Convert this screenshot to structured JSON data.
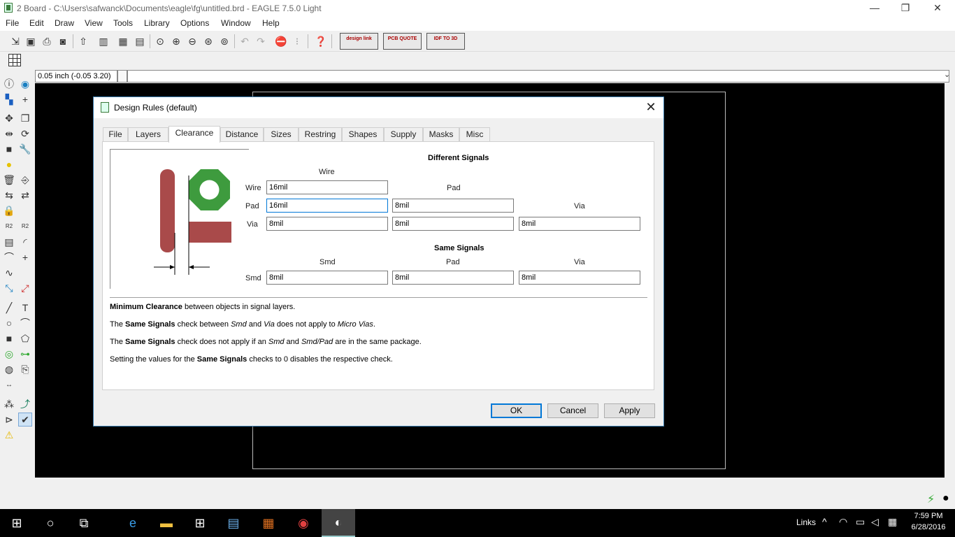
{
  "window": {
    "title": "2 Board - C:\\Users\\safwanck\\Documents\\eagle\\fg\\untitled.brd - EAGLE 7.5.0 Light",
    "minimize": "—",
    "maximize": "❐",
    "close": "✕"
  },
  "menu": [
    "File",
    "Edit",
    "Draw",
    "View",
    "Tools",
    "Library",
    "Options",
    "Window",
    "Help"
  ],
  "toolbar": {
    "design_link": "design link",
    "pcb_quote": "PCB QUOTE",
    "idf_to_3d": "IDF TO 3D"
  },
  "coordinates": {
    "display": "0.05 inch (-0.05 3.20)"
  },
  "dialog": {
    "title": "Design Rules (default)",
    "tabs": [
      "File",
      "Layers",
      "Clearance",
      "Distance",
      "Sizes",
      "Restring",
      "Shapes",
      "Supply",
      "Masks",
      "Misc"
    ],
    "active_tab": "Clearance",
    "different_signals": {
      "heading": "Different Signals",
      "col_wire": "Wire",
      "col_pad": "Pad",
      "col_via": "Via",
      "row_wire": "Wire",
      "row_pad": "Pad",
      "row_via": "Via",
      "wire_wire": "16mil",
      "pad_wire": "16mil",
      "pad_pad": "8mil",
      "via_wire": "8mil",
      "via_pad": "8mil",
      "via_via": "8mil"
    },
    "same_signals": {
      "heading": "Same Signals",
      "col_smd": "Smd",
      "col_pad": "Pad",
      "col_via": "Via",
      "row_smd": "Smd",
      "smd_smd": "8mil",
      "smd_pad": "8mil",
      "smd_via": "8mil"
    },
    "desc": {
      "l1_b": "Minimum Clearance",
      "l1_t": " between objects in signal layers.",
      "l2_a": "The ",
      "l2_b": "Same Signals",
      "l2_c": " check between ",
      "l2_i1": "Smd",
      "l2_d": " and ",
      "l2_i2": "Via",
      "l2_e": " does not apply to ",
      "l2_i3": "Micro Vias",
      "l2_f": ".",
      "l3_a": "The ",
      "l3_b": "Same Signals",
      "l3_c": " check does not apply if an ",
      "l3_i1": "Smd",
      "l3_d": " and ",
      "l3_i2": "Smd/Pad",
      "l3_e": " are in the same package.",
      "l4_a": "Setting the values for the ",
      "l4_b": "Same Signals",
      "l4_c": " checks to 0 disables the respective check."
    },
    "buttons": {
      "ok": "OK",
      "cancel": "Cancel",
      "apply": "Apply"
    }
  },
  "taskbar": {
    "links": "Links",
    "time": "7:59 PM",
    "date": "6/28/2016"
  },
  "colors": {
    "canvas": "#000000",
    "pad_red": "#a94a4a",
    "pad_green": "#3e9b3e",
    "accent": "#0078d7"
  }
}
